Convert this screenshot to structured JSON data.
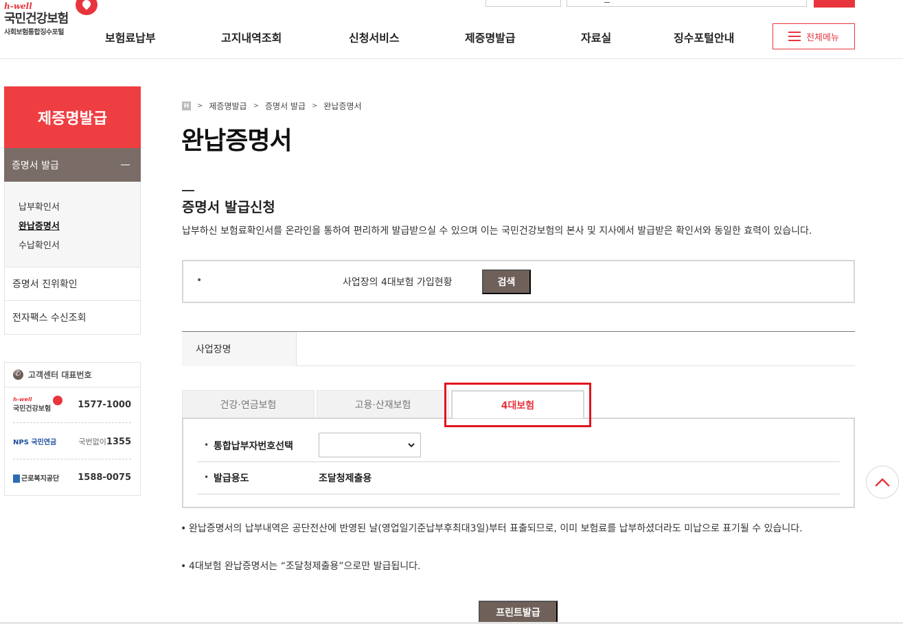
{
  "header": {
    "logo_tag": "h-well",
    "logo_name": "국민건강보험",
    "logo_sub": "사회보험통합징수포털",
    "nav": [
      "보험료납부",
      "고지내역조회",
      "신청서비스",
      "제증명발급",
      "자료실",
      "징수포털안내"
    ],
    "all_menu": "전체메뉴"
  },
  "sidebar": {
    "title": "제증명발급",
    "group": "증명서 발급",
    "sub_items": [
      "납부확인서",
      "완납증명서",
      "수납확인서"
    ],
    "active_sub": "완납증명서",
    "items": [
      "증명서 진위확인",
      "전자팩스 수신조회"
    ]
  },
  "customer_center": {
    "title": "고객센터 대표번호",
    "rows": [
      {
        "org": "국민건강보험",
        "tag": "h-well",
        "number": "1577-1000",
        "prefix": ""
      },
      {
        "org": "NPS 국민연금",
        "tag": "",
        "number": "1355",
        "prefix": "국번없이"
      },
      {
        "org": "근로복지공단",
        "tag": "",
        "number": "1588-0075",
        "prefix": ""
      }
    ]
  },
  "breadcrumb": {
    "home": "H",
    "items": [
      "제증명발급",
      "증명서 발급",
      "완납증명서"
    ]
  },
  "main": {
    "page_title": "완납증명서",
    "section_title": "증명서 발급신청",
    "description": "납부하신 보험료확인서를 온라인을 통하여 편리하게 발급받으실 수 있으며 이는 국민건강보험의 본사 및 지사에서 발급받은 확인서와 동일한 효력이 있습니다.",
    "search": {
      "bullet": "•",
      "label": "사업장의 4대보험 가입현황",
      "button": "검색"
    },
    "business": {
      "label": "사업장명",
      "value": ""
    },
    "tabs": [
      "건강·연금보험",
      "고용·산재보험",
      "4대보험"
    ],
    "active_tab": "4대보험",
    "form": {
      "payer_label": "통합납부자번호선택",
      "payer_selected": "",
      "purpose_label": "발급용도",
      "purpose_value": "조달청제출용"
    },
    "notes": [
      "완납증명서의 납부내역은 공단전산에 반영된 날(영업일기준납부후최대3일)부터 표출되므로, 이미 보험료를 납부하셨더라도 미납으로 표기될 수 있습니다.",
      "4대보험 완납증명서는 “조달청제출용”으로만 발급됩니다."
    ],
    "print_button": "프린트발급"
  },
  "colors": {
    "brand_red": "#ef3e42",
    "brown": "#6f615a",
    "highlight": "#e1141d"
  }
}
